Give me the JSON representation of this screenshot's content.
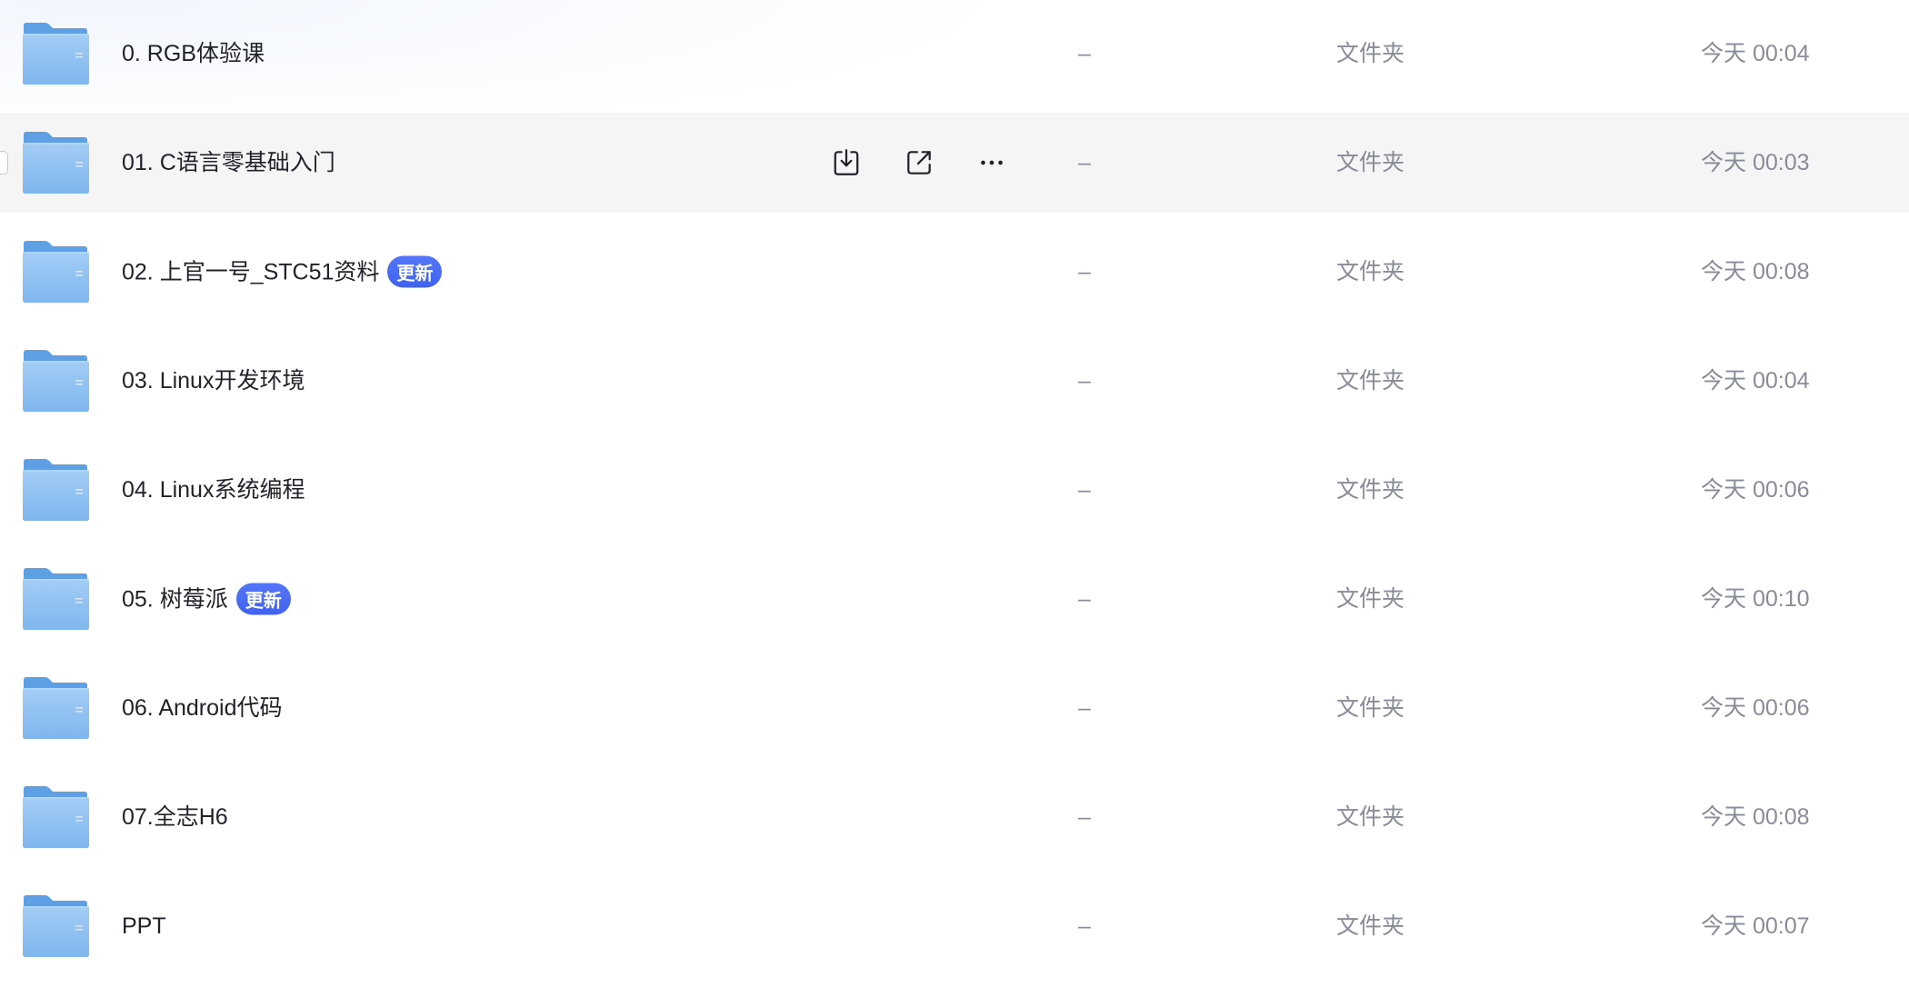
{
  "file_list": {
    "rows": [
      {
        "name": "0. RGB体验课",
        "size": "–",
        "type": "文件夹",
        "modified": "今天 00:04",
        "icon": "folder-icon"
      },
      {
        "name": "01. C语言零基础入门",
        "size": "–",
        "type": "文件夹",
        "modified": "今天 00:03",
        "icon": "folder-icon",
        "hovered": true
      },
      {
        "name": "02. 上官一号_STC51资料",
        "badge": "更新",
        "size": "–",
        "type": "文件夹",
        "modified": "今天 00:08",
        "icon": "folder-icon"
      },
      {
        "name": "03. Linux开发环境",
        "size": "–",
        "type": "文件夹",
        "modified": "今天 00:04",
        "icon": "folder-icon"
      },
      {
        "name": "04. Linux系统编程",
        "size": "–",
        "type": "文件夹",
        "modified": "今天 00:06",
        "icon": "folder-icon"
      },
      {
        "name": "05. 树莓派",
        "badge": "更新",
        "size": "–",
        "type": "文件夹",
        "modified": "今天 00:10",
        "icon": "folder-icon"
      },
      {
        "name": "06. Android代码",
        "size": "–",
        "type": "文件夹",
        "modified": "今天 00:06",
        "icon": "folder-icon"
      },
      {
        "name": "07.全志H6",
        "size": "–",
        "type": "文件夹",
        "modified": "今天 00:08",
        "icon": "folder-icon"
      },
      {
        "name": "PPT",
        "size": "–",
        "type": "文件夹",
        "modified": "今天 00:07",
        "icon": "folder-icon"
      }
    ],
    "row_actions": {
      "download": "download-icon",
      "share": "share-icon",
      "more": "more-icon"
    }
  },
  "colors": {
    "badge": "#4a6cf4",
    "hover_row": "#f5f5f6",
    "folder_front": "#8cbef2",
    "folder_back": "#5f9fe3",
    "text_primary": "#1f2329",
    "text_secondary": "#878c97"
  }
}
